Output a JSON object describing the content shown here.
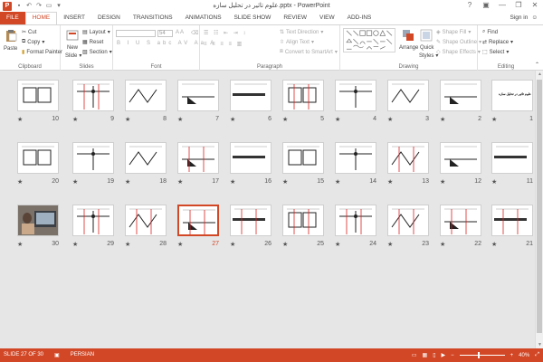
{
  "window": {
    "title": "علوم تاثیر در تحلیل سازه.pptx - PowerPoint",
    "help": "?",
    "minimize": "—",
    "restore": "❐",
    "close": "✕"
  },
  "tabs": [
    "FILE",
    "HOME",
    "INSERT",
    "DESIGN",
    "TRANSITIONS",
    "ANIMATIONS",
    "SLIDE SHOW",
    "REVIEW",
    "VIEW",
    "ADD-INS"
  ],
  "active_tab": "HOME",
  "sign_in": "Sign in",
  "ribbon": {
    "clipboard": {
      "label": "Clipboard",
      "paste": "Paste",
      "cut": "Cut",
      "copy": "Copy",
      "format_painter": "Format Painter"
    },
    "slides": {
      "label": "Slides",
      "new_slide": "New",
      "new_slide2": "Slide",
      "layout": "Layout",
      "reset": "Reset",
      "section": "Section"
    },
    "font": {
      "label": "Font",
      "size": "54"
    },
    "paragraph": {
      "label": "Paragraph",
      "text_direction": "Text Direction",
      "align_text": "Align Text",
      "convert_smartart": "Convert to SmartArt"
    },
    "drawing": {
      "label": "Drawing",
      "arrange": "Arrange",
      "quick_styles": "Quick",
      "quick_styles2": "Styles",
      "shape_fill": "Shape Fill",
      "shape_outline": "Shape Outline",
      "shape_effects": "Shape Effects"
    },
    "editing": {
      "label": "Editing",
      "find": "Find",
      "replace": "Replace",
      "select": "Select"
    }
  },
  "slides": [
    {
      "n": "1",
      "star": "★"
    },
    {
      "n": "2",
      "star": "★"
    },
    {
      "n": "3",
      "star": "★"
    },
    {
      "n": "4",
      "star": "★"
    },
    {
      "n": "5",
      "star": "★"
    },
    {
      "n": "6",
      "star": "★"
    },
    {
      "n": "7",
      "star": "★"
    },
    {
      "n": "8",
      "star": "★"
    },
    {
      "n": "9",
      "star": "★"
    },
    {
      "n": "10",
      "star": "★"
    },
    {
      "n": "11",
      "star": "★"
    },
    {
      "n": "12",
      "star": "★"
    },
    {
      "n": "13",
      "star": "★"
    },
    {
      "n": "14",
      "star": "★"
    },
    {
      "n": "15",
      "star": "★"
    },
    {
      "n": "16",
      "star": "★"
    },
    {
      "n": "17",
      "star": "★"
    },
    {
      "n": "18",
      "star": "★"
    },
    {
      "n": "19",
      "star": "★"
    },
    {
      "n": "20",
      "star": "★"
    },
    {
      "n": "21",
      "star": "★"
    },
    {
      "n": "22",
      "star": "★"
    },
    {
      "n": "23",
      "star": "★"
    },
    {
      "n": "24",
      "star": "★"
    },
    {
      "n": "25",
      "star": "★"
    },
    {
      "n": "26",
      "star": "★"
    },
    {
      "n": "27",
      "star": "★"
    },
    {
      "n": "28",
      "star": "★"
    },
    {
      "n": "29",
      "star": "★"
    },
    {
      "n": "30",
      "star": "★"
    }
  ],
  "slide1_title": "علوم تاثیر در تحلیل سازه",
  "selected_slide": "27",
  "status": {
    "slide": "SLIDE 27 OF 30",
    "language": "PERSIAN",
    "zoom": "40%",
    "zoom_minus": "−",
    "zoom_plus": "+"
  },
  "colors": {
    "accent": "#d24726",
    "status_bar": "#d24726"
  }
}
